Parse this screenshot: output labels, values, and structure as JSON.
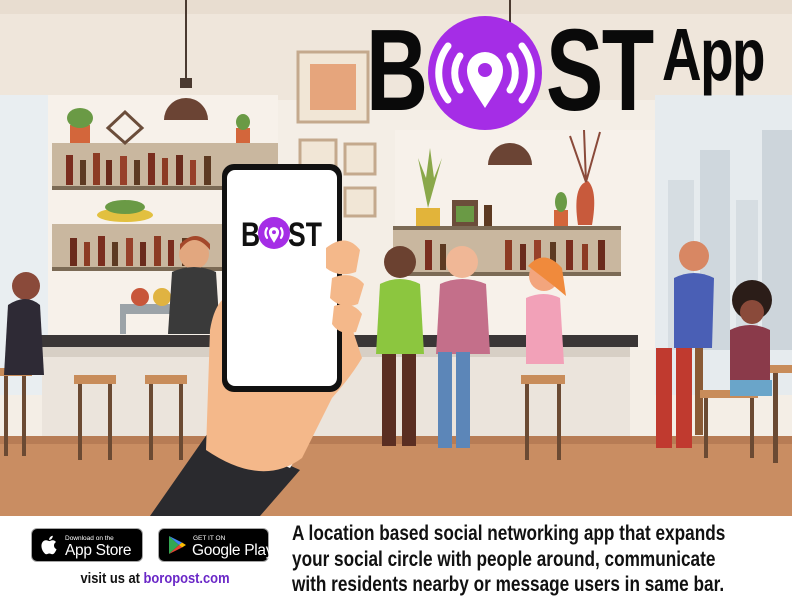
{
  "brand": {
    "logo_prefix": "B",
    "logo_suffix": "ST",
    "logo_app": "App",
    "phone_logo_prefix": "B",
    "phone_logo_suffix": "ST",
    "accent_color": "#a52de6",
    "icon": "location-pin-signal-icon"
  },
  "footer": {
    "app_store": {
      "small": "Download on the",
      "big": "App Store",
      "icon": "apple-icon"
    },
    "google_play": {
      "small": "GET IT ON",
      "big": "Google Play",
      "icon": "play-triangle-icon"
    },
    "visit_prefix": "visit us at ",
    "visit_link": "boropost.com",
    "description_lines": [
      "A location based social networking app that expands",
      "your social circle with people around, communicate",
      "with residents nearby or message users in same bar."
    ]
  }
}
